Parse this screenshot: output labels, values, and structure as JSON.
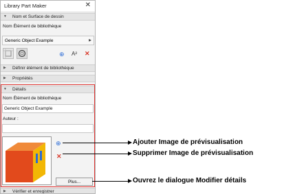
{
  "window": {
    "title": "Library Part Maker",
    "close_glyph": "✕"
  },
  "sections": {
    "nom_surface": "Nom et Surface de dessin",
    "definir": "Définir élément de bibliothèque",
    "proprietes": "Propriétés",
    "details": "Détails",
    "verifier": "Vérifier et enregistrer"
  },
  "top": {
    "name_label": "Nom Élément de bibliothèque",
    "selected_object": "Generic Object Example",
    "tools": {
      "add": "⊕",
      "font": "A²",
      "delete": "✕"
    }
  },
  "details": {
    "name_label": "Nom Élément de bibliothèque",
    "name_value": "Generic Object Example",
    "author_label": "Auteur :",
    "author_value": "",
    "add_preview": "⊕",
    "remove_preview": "✕",
    "plus_button": "Plus..."
  },
  "annotations": {
    "add_preview": "Ajouter Image de prévisualisation",
    "remove_preview": "Supprimer Image de prévisualisation",
    "open_dialog": "Ouvrez le dialogue Modifier détails"
  },
  "colors": {
    "highlight": "#e0322f",
    "accent_blue": "#2b6bd6",
    "delete_red": "#d93a2b"
  }
}
